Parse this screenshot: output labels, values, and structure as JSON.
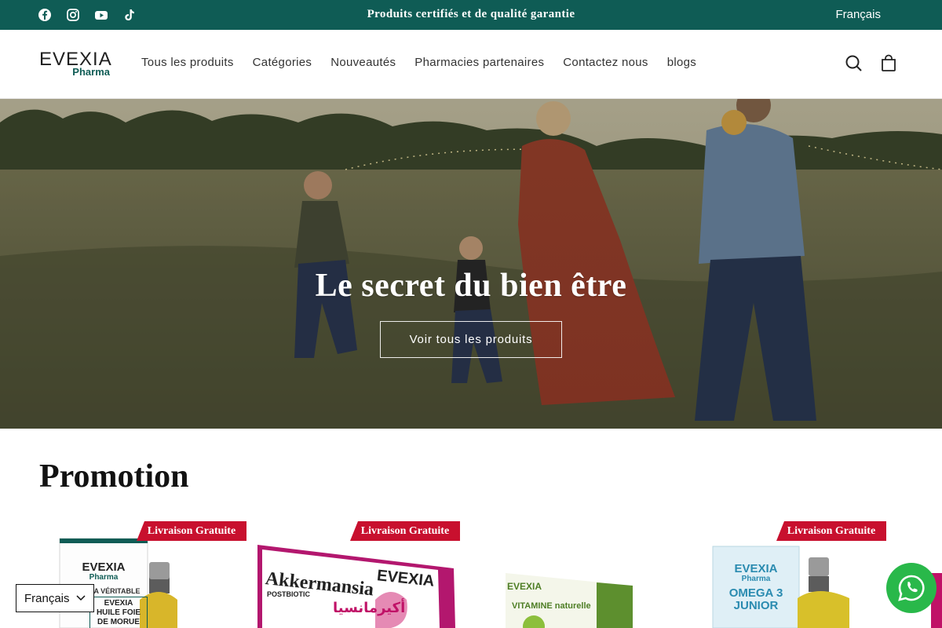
{
  "topbar": {
    "announcement": "Produits certifiés et de qualité garantie",
    "language": "Français",
    "social": [
      "facebook-icon",
      "instagram-icon",
      "youtube-icon",
      "tiktok-icon"
    ],
    "background": "#0f5c55"
  },
  "header": {
    "logo_main": "EVEXIA",
    "logo_sub": "Pharma",
    "nav": [
      "Tous les produits",
      "Catégories",
      "Nouveautés",
      "Pharmacies partenaires",
      "Contactez nous",
      "blogs"
    ],
    "icons": [
      "search-icon",
      "cart-icon"
    ]
  },
  "hero": {
    "title": "Le secret du bien être",
    "cta": "Voir tous les produits"
  },
  "promotion": {
    "title": "Promotion",
    "ribbon": "Livraison Gratuite",
    "products": [
      {
        "brand": "EVEXIA",
        "brand_sub": "Pharma",
        "top_label": "LA VÉRITABLE",
        "name_line1": "EVEXIA",
        "name_line2": "HUILE FOIE",
        "name_line3": "DE MORUE"
      },
      {
        "brand": "EVEXIA",
        "name": "Akkermansia",
        "subtitle": "POSTBIOTIC",
        "arabic": "أكيرمانسيا"
      },
      {
        "brand": "EVEXIA",
        "name": "VITAMINE naturelle"
      },
      {
        "brand": "EVEXIA",
        "brand_sub": "Pharma",
        "name_line1": "OMEGA 3",
        "name_line2": "JUNIOR"
      }
    ]
  },
  "footer_widgets": {
    "language": "Français",
    "chat_icon": "whatsapp-icon",
    "chat_color": "#29b84a"
  },
  "colors": {
    "accent": "#0f5c55",
    "ribbon": "#c8102e"
  }
}
